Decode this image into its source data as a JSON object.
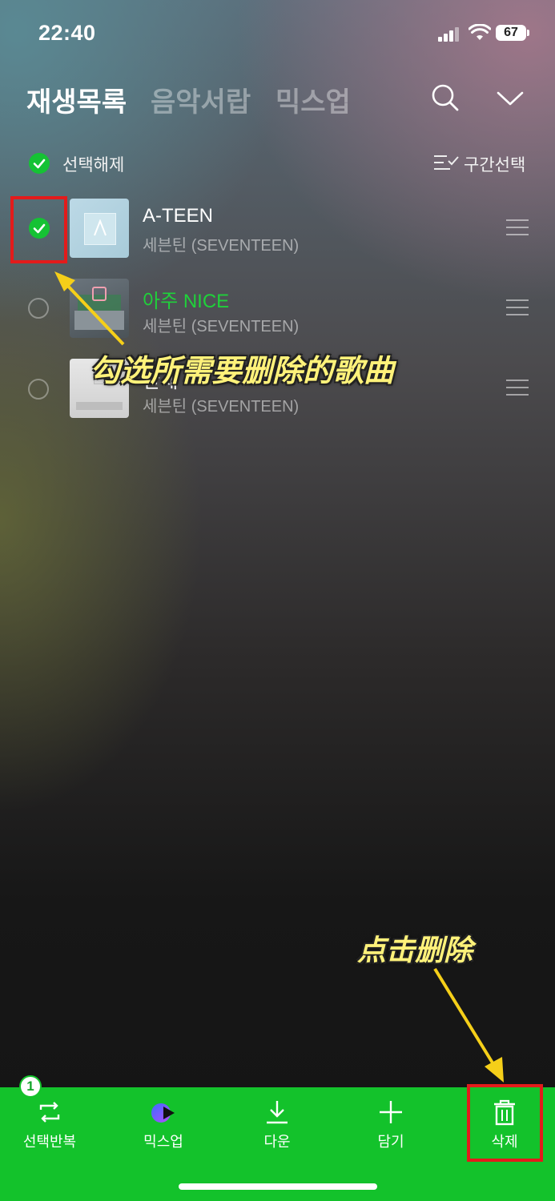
{
  "status_bar": {
    "time": "22:40",
    "battery": "67",
    "icons": [
      "signal-icon",
      "wifi-icon",
      "battery-icon"
    ]
  },
  "header": {
    "tabs": [
      {
        "label": "재생목록",
        "active": true
      },
      {
        "label": "음악서랍",
        "active": false
      },
      {
        "label": "믹스업",
        "active": false
      }
    ],
    "icons": [
      "search-icon",
      "chevron-down-icon"
    ]
  },
  "toolbar": {
    "deselect_label": "선택해제",
    "range_select_label": "구간선택",
    "icons": [
      "check-circle-icon",
      "range-select-icon"
    ]
  },
  "songs": [
    {
      "title": "A-TEEN",
      "artist": "세븐틴 (SEVENTEEN)",
      "selected": true,
      "playing": false
    },
    {
      "title": "아주 NICE",
      "artist": "세븐틴 (SEVENTEEN)",
      "selected": false,
      "playing": true
    },
    {
      "title": "만세",
      "artist": "세븐틴 (SEVENTEEN)",
      "selected": false,
      "playing": false
    }
  ],
  "annotations": {
    "select_hint": "勾选所需要删除的歌曲",
    "delete_hint": "点击删除"
  },
  "bottom_bar": {
    "selected_count": "1",
    "items": [
      {
        "label": "선택반복",
        "icon": "repeat-icon"
      },
      {
        "label": "믹스업",
        "icon": "mixup-icon"
      },
      {
        "label": "다운",
        "icon": "download-icon"
      },
      {
        "label": "담기",
        "icon": "plus-icon"
      },
      {
        "label": "삭제",
        "icon": "trash-icon"
      }
    ]
  },
  "colors": {
    "accent_green": "#13c22b",
    "playing_green": "#1fd13a",
    "annotation_red": "#e31b1b",
    "annotation_yellow": "#fff27a"
  }
}
